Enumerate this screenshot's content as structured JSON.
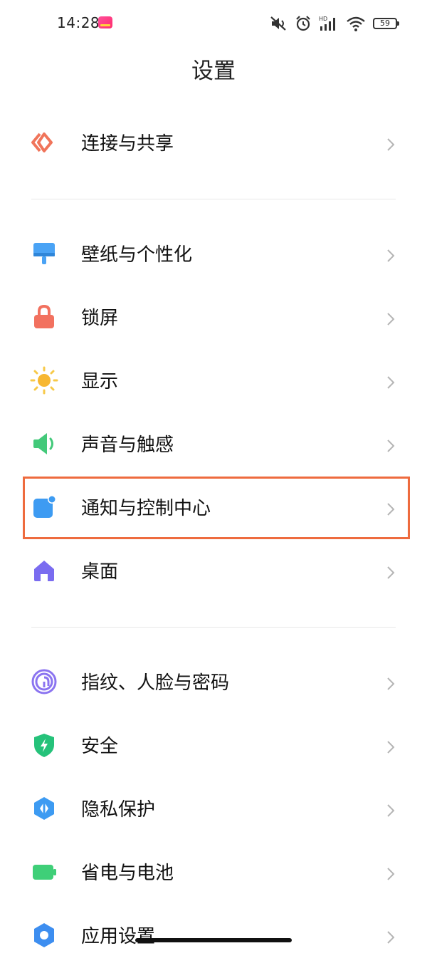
{
  "status_bar": {
    "time": "14:28",
    "battery": "59",
    "icons": [
      "mute-icon",
      "alarm-icon",
      "hd-signal-icon",
      "wifi-icon",
      "battery-icon"
    ]
  },
  "page": {
    "title": "设置"
  },
  "items": [
    {
      "label": "连接与共享",
      "icon": "connection-share-icon",
      "color": "#f0745a"
    },
    {
      "label": "壁纸与个性化",
      "icon": "wallpaper-icon",
      "color": "#4aa3f5"
    },
    {
      "label": "锁屏",
      "icon": "lock-icon",
      "color": "#f2715f"
    },
    {
      "label": "显示",
      "icon": "sun-icon",
      "color": "#f7b731"
    },
    {
      "label": "声音与触感",
      "icon": "speaker-icon",
      "color": "#43c97a"
    },
    {
      "label": "通知与控制中心",
      "icon": "notification-icon",
      "color": "#3d9bf2"
    },
    {
      "label": "桌面",
      "icon": "home-icon",
      "color": "#7a6cf0"
    },
    {
      "label": "指纹、人脸与密码",
      "icon": "fingerprint-icon",
      "color": "#8b74f0"
    },
    {
      "label": "安全",
      "icon": "shield-icon",
      "color": "#25c27a"
    },
    {
      "label": "隐私保护",
      "icon": "privacy-icon",
      "color": "#3d9bf2"
    },
    {
      "label": "省电与电池",
      "icon": "battery-icon",
      "color": "#3fcf78"
    },
    {
      "label": "应用设置",
      "icon": "gear-icon",
      "color": "#3d8ef0"
    }
  ],
  "highlight_color": "#ee6b3e"
}
